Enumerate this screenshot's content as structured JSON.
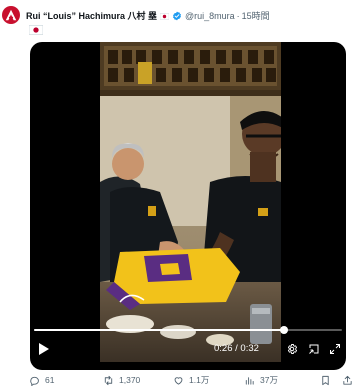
{
  "post": {
    "author": {
      "display_name": "Rui “Louis” Hachimura 八村 塁",
      "handle": "@rui_8mura",
      "time": "15時間",
      "verified": true,
      "flag_icon": "japan-flag-icon",
      "avatar_icon": "monogram-logo-avatar"
    },
    "text_emoji": "japan-flag-emoji",
    "video": {
      "current_time": "0:26",
      "duration": "0:32",
      "time_separator": "/",
      "progress": 0.8125
    },
    "actions": {
      "reply_count": "61",
      "repost_count": "1,370",
      "like_count": "1.1万",
      "view_count": "37万"
    },
    "colors": {
      "accent": "#1d9bf0",
      "avatar_bg": "#c8102e",
      "muted_text": "#536471",
      "text": "#0f1419"
    }
  }
}
